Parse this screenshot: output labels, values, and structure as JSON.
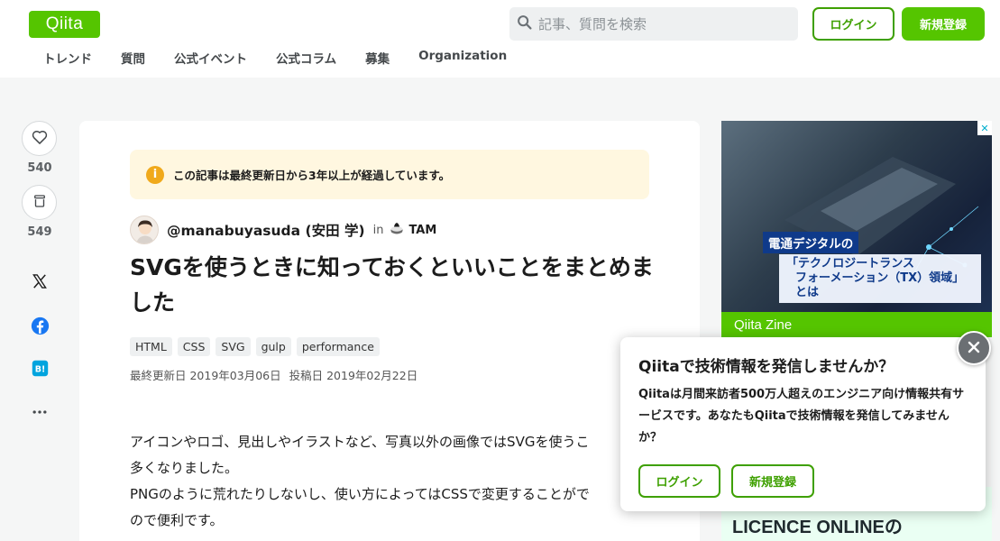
{
  "header": {
    "logo": "Qiita",
    "search_placeholder": "記事、質問を検索",
    "login_label": "ログイン",
    "signup_label": "新規登録",
    "nav": [
      "トレンド",
      "質問",
      "公式イベント",
      "公式コラム",
      "募集",
      "Organization"
    ]
  },
  "rail": {
    "like_count": "540",
    "stock_count": "549",
    "icons": [
      "heart-icon",
      "stock-icon",
      "x-icon",
      "facebook-icon",
      "hatena-bookmark-icon",
      "more-icon"
    ]
  },
  "article": {
    "notice": "この記事は最終更新日から3年以上が経過しています。",
    "author": "@manabuyasuda (安田 学)",
    "in_label": "in",
    "organization": "TAM",
    "title": "SVGを使うときに知っておくといいことをまとめました",
    "tags": [
      "HTML",
      "CSS",
      "SVG",
      "gulp",
      "performance"
    ],
    "updated": "最終更新日 2019年03月06日",
    "posted": "投稿日 2019年02月22日",
    "body": [
      "アイコンやロゴ、見出しやイラストなど、写真以外の画像ではSVGを使うこ",
      "多くなりました。",
      "PNGのように荒れたりしないし、使い方によってはCSSで変更することがで",
      "ので便利です。"
    ]
  },
  "ad": {
    "label1": "電通デジタルの",
    "label2_line1": "「テクノロジートランス",
    "label2_line2": "フォーメーション（TX）領域」とは",
    "zine": "Qiita Zine",
    "bottom": "LICENCE ONLINEの"
  },
  "popup": {
    "title": "Qiitaで技術情報を発信しませんか？",
    "text": "Qiitaは月間来訪者500万人超えのエンジニア向け情報共有サービスです。あなたもQiitaで技術情報を発信してみませんか？",
    "login_label": "ログイン",
    "signup_label": "新規登録"
  },
  "colors": {
    "brand": "#55c500",
    "brand_dark": "#3ea000",
    "notice_bg": "#fff7e0",
    "notice_icon": "#f0a91b"
  }
}
